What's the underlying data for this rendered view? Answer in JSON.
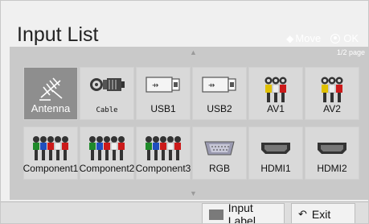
{
  "header": {
    "title": "Input List",
    "move_label": "Move",
    "ok_label": "OK"
  },
  "grid": {
    "page_indicator": "1/2 page",
    "tiles": [
      {
        "label": "Antenna",
        "icon": "antenna-icon",
        "selected": true
      },
      {
        "label": "Cable",
        "icon": "cable-connector-icon",
        "selected": false
      },
      {
        "label": "USB1",
        "icon": "usb-icon",
        "selected": false
      },
      {
        "label": "USB2",
        "icon": "usb-icon",
        "selected": false
      },
      {
        "label": "AV1",
        "icon": "av-rca-icon",
        "selected": false
      },
      {
        "label": "AV2",
        "icon": "av-rca-icon",
        "selected": false
      },
      {
        "label": "Component1",
        "icon": "component-rca-icon",
        "selected": false
      },
      {
        "label": "Component2",
        "icon": "component-rca-icon",
        "selected": false
      },
      {
        "label": "Component3",
        "icon": "component-rca-icon",
        "selected": false
      },
      {
        "label": "RGB",
        "icon": "rgb-vga-icon",
        "selected": false
      },
      {
        "label": "HDMI1",
        "icon": "hdmi-icon",
        "selected": false
      },
      {
        "label": "HDMI2",
        "icon": "hdmi-icon",
        "selected": false
      }
    ]
  },
  "footer": {
    "input_label": "Input Label",
    "exit_label": "Exit"
  },
  "colors": {
    "selected_tile": "#8e8e8e",
    "tile": "#d9d9d9",
    "grid_background": "#c9c9c9"
  }
}
